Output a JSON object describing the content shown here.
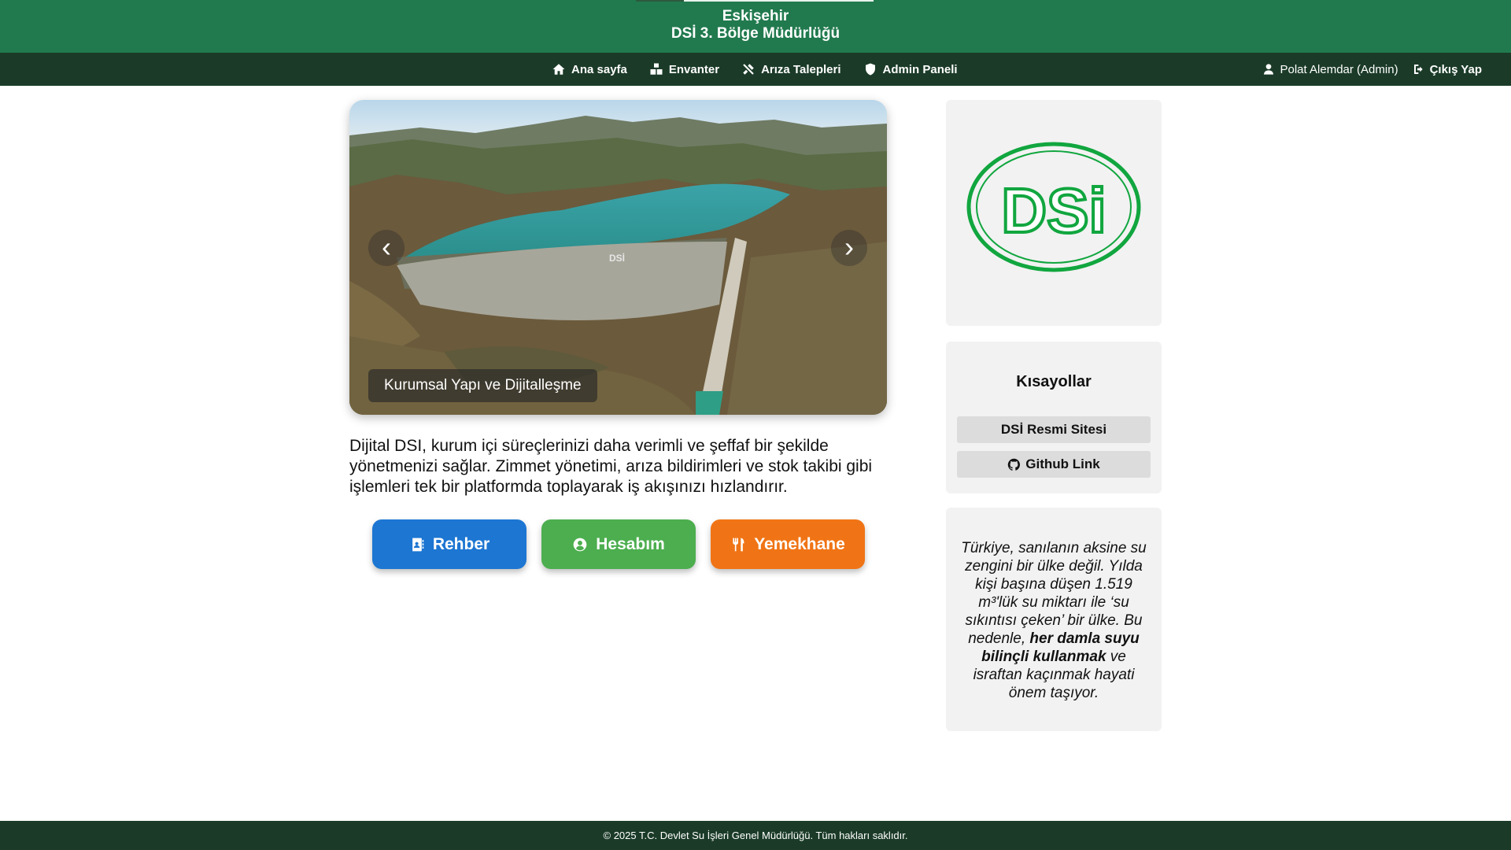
{
  "header": {
    "city": "Eskişehir",
    "org": "DSİ 3. Bölge Müdürlüğü"
  },
  "nav": {
    "items": [
      {
        "label": "Ana sayfa"
      },
      {
        "label": "Envanter"
      },
      {
        "label": "Arıza Talepleri"
      },
      {
        "label": "Admin Paneli"
      }
    ],
    "user": "Polat Alemdar (Admin)",
    "logout": "Çıkış Yap"
  },
  "carousel": {
    "caption": "Kurumsal Yapı ve Dijitalleşme",
    "prev": "‹",
    "next": "›",
    "dam_text": "DSİ"
  },
  "intro": "Dijital DSI, kurum içi süreçlerinizi daha verimli ve şeffaf bir şekilde yönetmenizi sağlar. Zimmet yönetimi, arıza bildirimleri ve stok takibi gibi işlemleri tek bir platformda toplayarak iş akışınızı hızlandırır.",
  "actions": {
    "rehber": "Rehber",
    "hesabim": "Hesabım",
    "yemekhane": "Yemekhane",
    "colors": {
      "rehber": "#1c76d2",
      "hesabim": "#4cae4f",
      "yemekhane": "#f07415"
    }
  },
  "logo": {
    "text": "DSi",
    "color": "#11a63f"
  },
  "shortcuts": {
    "title": "Kısayollar",
    "items": [
      {
        "label": "DSİ Resmi Sitesi"
      },
      {
        "label": "Github Link"
      }
    ]
  },
  "quote": {
    "part1": "Türkiye, sanılanın aksine su zengini bir ülke değil. Yılda kişi başına düşen 1.519 m³'lük su miktarı ile ‘su sıkıntısı çeken’ bir ülke. Bu nedenle,",
    "bold": "her damla suyu bilinçli kullanmak",
    "part2": "ve israftan kaçınmak hayati önem taşıyor."
  },
  "footer": "© 2025 T.C. Devlet Su İşleri Genel Müdürlüğü. Tüm hakları saklıdır.",
  "theme": {
    "header": "#217a4e",
    "navbar": "#1b3b28"
  }
}
